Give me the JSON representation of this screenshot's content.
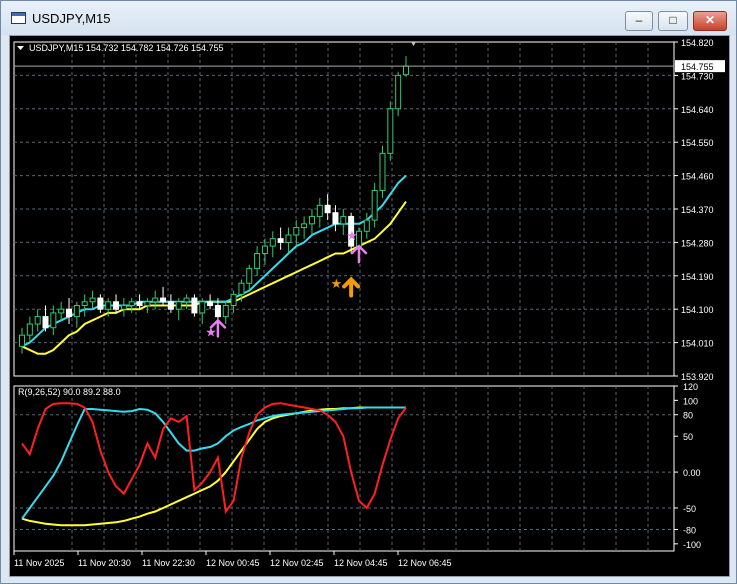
{
  "window": {
    "title": "USDJPY,M15",
    "minimize_glyph": "–",
    "maximize_glyph": "□",
    "close_glyph": "✕"
  },
  "colors": {
    "background": "#000000",
    "grid": "#596673",
    "bull_candle": "#2ecc71",
    "bear_candle": "#ffffff",
    "ma_fast": "#33ddf0",
    "ma_slow": "#ffff33",
    "osc_red": "#ff2020",
    "arrow_magenta": "#e880f0",
    "arrow_orange": "#f59c00",
    "current_price_line": "#aaaaaa"
  },
  "main_chart": {
    "label": "USDJPY,M15  154.732 154.782 154.726 154.755",
    "current_price": "154.755",
    "price_labels": [
      "154.820",
      "154.730",
      "154.640",
      "154.550",
      "154.460",
      "154.370",
      "154.280",
      "154.190",
      "154.100",
      "154.010",
      "153.920"
    ]
  },
  "indicator": {
    "label": "R(9,26,52) 90.0 89.2 88.0",
    "scale_labels": [
      "120",
      "100",
      "80",
      "50",
      "0.00",
      "-50",
      "-80",
      "-100"
    ]
  },
  "time_labels": [
    "11 Nov 2025",
    "11 Nov 20:30",
    "11 Nov 22:30",
    "12 Nov 00:45",
    "12 Nov 02:45",
    "12 Nov 04:45",
    "12 Nov 06:45"
  ],
  "chart_data": {
    "type": "candlestick",
    "symbol": "USDJPY",
    "timeframe": "M15",
    "ohlc_last": {
      "open": 154.732,
      "high": 154.782,
      "low": 154.726,
      "close": 154.755
    },
    "ylim": [
      153.92,
      154.82
    ],
    "candles": [
      [
        154.0,
        154.05,
        153.98,
        154.03
      ],
      [
        154.03,
        154.08,
        154.01,
        154.06
      ],
      [
        154.06,
        154.1,
        154.04,
        154.08
      ],
      [
        154.08,
        154.11,
        154.04,
        154.05
      ],
      [
        154.05,
        154.11,
        154.03,
        154.09
      ],
      [
        154.09,
        154.12,
        154.07,
        154.1
      ],
      [
        154.1,
        154.13,
        154.06,
        154.08
      ],
      [
        154.08,
        154.12,
        154.05,
        154.11
      ],
      [
        154.11,
        154.14,
        154.08,
        154.12
      ],
      [
        154.12,
        154.15,
        154.1,
        154.13
      ],
      [
        154.13,
        154.14,
        154.09,
        154.1
      ],
      [
        154.1,
        154.13,
        154.08,
        154.12
      ],
      [
        154.12,
        154.14,
        154.09,
        154.1
      ],
      [
        154.1,
        154.13,
        154.08,
        154.11
      ],
      [
        154.11,
        154.13,
        154.09,
        154.12
      ],
      [
        154.12,
        154.14,
        154.1,
        154.11
      ],
      [
        154.11,
        154.13,
        154.09,
        154.12
      ],
      [
        154.12,
        154.15,
        154.1,
        154.13
      ],
      [
        154.13,
        154.16,
        154.11,
        154.12
      ],
      [
        154.12,
        154.14,
        154.09,
        154.1
      ],
      [
        154.1,
        154.13,
        154.07,
        154.12
      ],
      [
        154.12,
        154.14,
        154.1,
        154.13
      ],
      [
        154.13,
        154.14,
        154.08,
        154.09
      ],
      [
        154.09,
        154.13,
        154.06,
        154.12
      ],
      [
        154.12,
        154.14,
        154.1,
        154.11
      ],
      [
        154.11,
        154.13,
        154.07,
        154.08
      ],
      [
        154.08,
        154.12,
        154.06,
        154.11
      ],
      [
        154.11,
        154.15,
        154.09,
        154.14
      ],
      [
        154.14,
        154.18,
        154.12,
        154.17
      ],
      [
        154.17,
        154.22,
        154.15,
        154.21
      ],
      [
        154.21,
        154.27,
        154.19,
        154.25
      ],
      [
        154.25,
        154.29,
        154.22,
        154.27
      ],
      [
        154.27,
        154.31,
        154.24,
        154.29
      ],
      [
        154.29,
        154.32,
        154.26,
        154.28
      ],
      [
        154.28,
        154.32,
        154.25,
        154.3
      ],
      [
        154.3,
        154.34,
        154.27,
        154.32
      ],
      [
        154.32,
        154.35,
        154.29,
        154.33
      ],
      [
        154.33,
        154.37,
        154.3,
        154.35
      ],
      [
        154.35,
        154.4,
        154.32,
        154.38
      ],
      [
        154.38,
        154.41,
        154.34,
        154.36
      ],
      [
        154.36,
        154.38,
        154.31,
        154.33
      ],
      [
        154.33,
        154.37,
        154.3,
        154.35
      ],
      [
        154.35,
        154.36,
        154.25,
        154.27
      ],
      [
        154.27,
        154.32,
        154.26,
        154.31
      ],
      [
        154.31,
        154.36,
        154.29,
        154.34
      ],
      [
        154.34,
        154.44,
        154.32,
        154.42
      ],
      [
        154.42,
        154.54,
        154.4,
        154.52
      ],
      [
        154.52,
        154.66,
        154.5,
        154.64
      ],
      [
        154.64,
        154.74,
        154.62,
        154.73
      ],
      [
        154.732,
        154.782,
        154.726,
        154.755
      ]
    ],
    "ma_fast": [
      154.0,
      154.01,
      154.03,
      154.05,
      154.06,
      154.07,
      154.08,
      154.09,
      154.1,
      154.1,
      154.11,
      154.11,
      154.11,
      154.11,
      154.11,
      154.12,
      154.12,
      154.12,
      154.12,
      154.12,
      154.12,
      154.12,
      154.12,
      154.12,
      154.12,
      154.12,
      154.12,
      154.13,
      154.14,
      154.15,
      154.17,
      154.19,
      154.21,
      154.23,
      154.25,
      154.27,
      154.28,
      154.3,
      154.31,
      154.32,
      154.33,
      154.33,
      154.33,
      154.33,
      154.34,
      154.36,
      154.38,
      154.41,
      154.44,
      154.46
    ],
    "ma_slow": [
      154.0,
      153.99,
      153.98,
      153.98,
      153.99,
      154.01,
      154.03,
      154.04,
      154.06,
      154.07,
      154.08,
      154.09,
      154.09,
      154.1,
      154.1,
      154.1,
      154.11,
      154.11,
      154.11,
      154.11,
      154.11,
      154.11,
      154.11,
      154.12,
      154.12,
      154.12,
      154.12,
      154.12,
      154.13,
      154.14,
      154.15,
      154.16,
      154.17,
      154.18,
      154.19,
      154.2,
      154.21,
      154.22,
      154.23,
      154.24,
      154.25,
      154.25,
      154.26,
      154.27,
      154.28,
      154.29,
      154.31,
      154.33,
      154.36,
      154.39
    ],
    "arrows_up": [
      {
        "index": 25,
        "price": 154.07,
        "color": "magenta"
      },
      {
        "index": 43,
        "price": 154.27,
        "color": "magenta"
      },
      {
        "index": 42,
        "price": 154.18,
        "color": "orange"
      }
    ],
    "stars": [
      {
        "index": 24,
        "price": 154.04,
        "color": "magenta"
      },
      {
        "index": 42,
        "price": 154.3,
        "color": "magenta"
      },
      {
        "index": 40,
        "price": 154.17,
        "color": "orange"
      }
    ],
    "oscillator": {
      "label": "R(9,26,52)",
      "last_values": [
        90.0,
        89.2,
        88.0
      ],
      "ylim": [
        -110,
        120
      ],
      "red": [
        40,
        25,
        60,
        88,
        95,
        96,
        96,
        95,
        90,
        70,
        30,
        0,
        -20,
        -30,
        -10,
        10,
        40,
        20,
        60,
        75,
        70,
        78,
        -25,
        -15,
        0,
        20,
        -55,
        -40,
        20,
        55,
        80,
        90,
        95,
        96,
        94,
        92,
        90,
        88,
        86,
        80,
        70,
        50,
        0,
        -40,
        -50,
        -30,
        10,
        45,
        75,
        90
      ],
      "cyan": [
        -65,
        -50,
        -35,
        -20,
        -5,
        15,
        40,
        65,
        88,
        88,
        87,
        86,
        85,
        84,
        85,
        88,
        87,
        82,
        70,
        55,
        40,
        30,
        30,
        33,
        35,
        40,
        50,
        58,
        63,
        67,
        72,
        75,
        78,
        80,
        81,
        82,
        83,
        84,
        85,
        86,
        87,
        88,
        89,
        89,
        90,
        90,
        90,
        90,
        90,
        90
      ],
      "yellow": [
        -65,
        -68,
        -70,
        -72,
        -73,
        -74,
        -74,
        -74,
        -74,
        -73,
        -72,
        -71,
        -70,
        -68,
        -65,
        -62,
        -58,
        -55,
        -50,
        -45,
        -40,
        -35,
        -30,
        -25,
        -20,
        -12,
        0,
        15,
        30,
        45,
        60,
        70,
        75,
        78,
        80,
        82,
        84,
        86,
        87,
        88,
        88,
        89,
        89,
        90,
        90,
        90,
        90,
        90,
        90,
        90
      ]
    }
  }
}
